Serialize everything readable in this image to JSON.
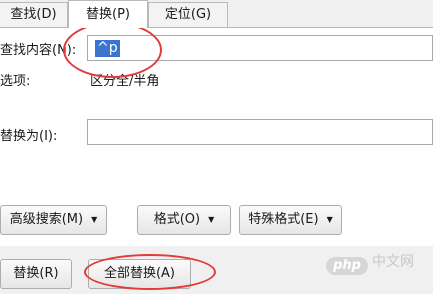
{
  "tabs": [
    {
      "label": "查找(D)"
    },
    {
      "label": "替换(P)"
    },
    {
      "label": "定位(G)"
    }
  ],
  "find": {
    "label": "查找内容(N):",
    "value": "^p"
  },
  "options": {
    "label": "选项:",
    "value": "区分全/半角"
  },
  "replace": {
    "label": "替换为(I):",
    "value": ""
  },
  "toolbar": {
    "advanced_search_label": "高级搜索(M)",
    "format_label": "格式(O)",
    "special_format_label": "特殊格式(E)"
  },
  "actions": {
    "replace_label": "替换(R)",
    "replace_all_label": "全部替换(A)"
  },
  "watermark": {
    "logo": "php",
    "text": "中文网"
  },
  "colors": {
    "selection": "#3b75cf",
    "annotation": "#e23a3a"
  }
}
